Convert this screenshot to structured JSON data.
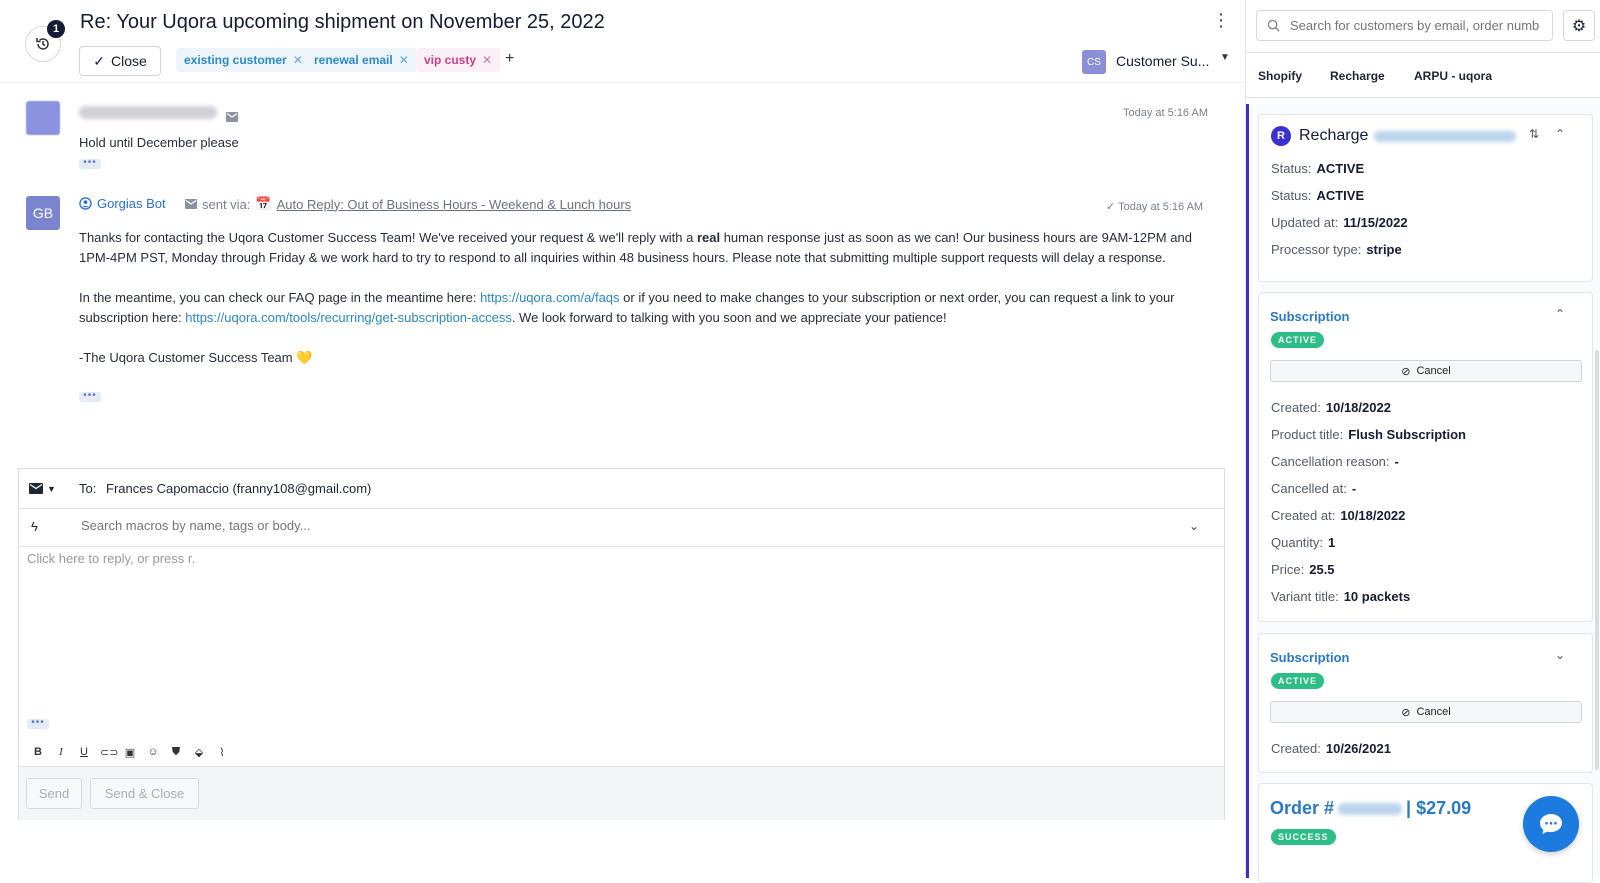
{
  "ticket": {
    "history_count": "1",
    "subject": "Re: Your Uqora upcoming shipment on November 25, 2022",
    "close_label": "Close",
    "tags": [
      {
        "label": "existing customer",
        "color": "#2b8ac8"
      },
      {
        "label": "renewal email",
        "color": "#2b8ac8"
      },
      {
        "label": "vip custy",
        "color": "#cc3d8a"
      }
    ],
    "add_tag": "+",
    "team_initials": "CS",
    "team_label": "Customer Su...",
    "more_icon": "vertical-dots-icon"
  },
  "messages": [
    {
      "time": "Today at 5:16 AM",
      "body": "Hold until December please"
    },
    {
      "initials": "GB",
      "sender": "Gorgias Bot",
      "sent_via": "sent via:",
      "rule": "Auto Reply: Out of Business Hours - Weekend & Lunch hours",
      "time": "Today at 5:16 AM",
      "p1_a": "Thanks for contacting the Uqora Customer Success Team! We've received your request & we'll reply with a ",
      "p1_bold": "real",
      "p1_b": " human response just as soon as we can! Our business hours are 9AM-12PM and 1PM-4PM PST, Monday through Friday & we work hard to try to respond to all inquiries within 48 business hours. Please note that submitting multiple support requests will delay a response.",
      "p2_a": "In the meantime, you can check our FAQ page in the meantime here: ",
      "p2_link1": "https://uqora.com/a/faqs",
      "p2_b": " or if you need to make changes to your subscription or next order, you can request a link to your subscription here: ",
      "p2_link2": "https://uqora.com/tools/recurring/get-subscription-access",
      "p2_c": ". We look forward to talking with you soon and we appreciate your patience!",
      "signature": "-The Uqora Customer Success Team 💛"
    }
  ],
  "composer": {
    "to_label": "To:",
    "to_value": "Frances Capomaccio (franny108@gmail.com)",
    "macro_placeholder": "Search macros by name, tags or body...",
    "reply_placeholder": "Click here to reply, or press r.",
    "toolbar": [
      "B",
      "I",
      "U",
      "link",
      "image",
      "emoji",
      "shopify",
      "attach-tag",
      "paperclip"
    ],
    "send_label": "Send",
    "send_close_label": "Send & Close"
  },
  "sidebar": {
    "search_placeholder": "Search for customers by email, order number",
    "tabs": [
      "Shopify",
      "Recharge",
      "ARPU - uqora"
    ],
    "recharge": {
      "title": "Recharge",
      "status1_label": "Status:",
      "status1_value": "ACTIVE",
      "status2_label": "Status:",
      "status2_value": "ACTIVE",
      "updated_label": "Updated at:",
      "updated_value": "11/15/2022",
      "processor_label": "Processor type:",
      "processor_value": "stripe"
    },
    "subscriptions": [
      {
        "title": "Subscription",
        "badge": "ACTIVE",
        "cancel_label": "Cancel",
        "fields": [
          {
            "label": "Created:",
            "value": "10/18/2022"
          },
          {
            "label": "Product title:",
            "value": "Flush Subscription"
          },
          {
            "label": "Cancellation reason:",
            "value": "-"
          },
          {
            "label": "Cancelled at:",
            "value": "-"
          },
          {
            "label": "Created at:",
            "value": "10/18/2022"
          },
          {
            "label": "Quantity:",
            "value": "1"
          },
          {
            "label": "Price:",
            "value": "25.5"
          },
          {
            "label": "Variant title:",
            "value": "10 packets"
          }
        ]
      },
      {
        "title": "Subscription",
        "badge": "ACTIVE",
        "cancel_label": "Cancel",
        "fields": [
          {
            "label": "Created:",
            "value": "10/26/2021"
          }
        ]
      }
    ],
    "order": {
      "prefix": "Order #",
      "amount": "| $27.09",
      "badge": "SUCCESS"
    }
  },
  "colors": {
    "accent": "#2b79c2",
    "success": "#2dbd87",
    "panel_border": "#3b2fcf",
    "chat_button": "#1d7be0"
  }
}
